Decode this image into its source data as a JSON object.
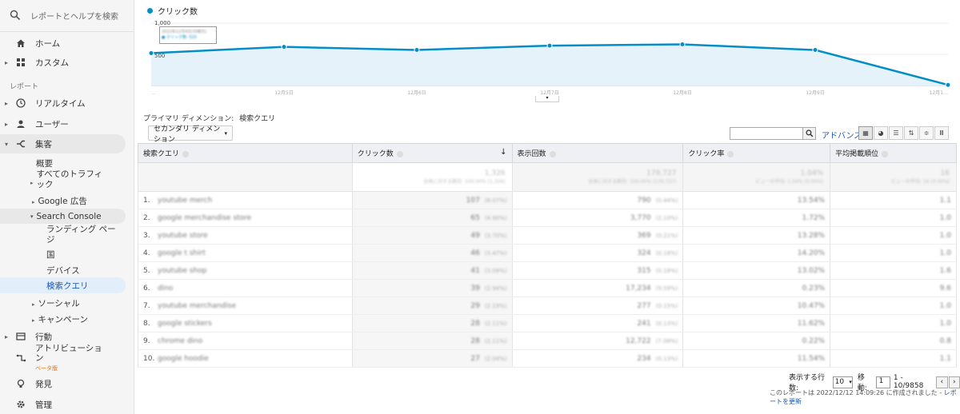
{
  "sidebar": {
    "search_label": "レポートとヘルプを検索",
    "home": "ホーム",
    "custom": "カスタム",
    "section_reports": "レポート",
    "realtime": "リアルタイム",
    "user": "ユーザー",
    "acquisition": "集客",
    "overview": "概要",
    "all_traffic_1": "すべてのトラフィ",
    "all_traffic_2": "ック",
    "google_ads": "Google 広告",
    "search_console": "Search Console",
    "landing_1": "ランディング ペー",
    "landing_2": "ジ",
    "country": "国",
    "device": "デバイス",
    "search_query": "検索クエリ",
    "social": "ソーシャル",
    "campaign": "キャンペーン",
    "behavior": "行動",
    "attribution_1": "アトリビューショ",
    "attribution_2": "ン",
    "beta": "ベータ版",
    "discover": "発見",
    "admin": "管理"
  },
  "chart": {
    "legend": "クリック数",
    "ytop": "1,000",
    "ymid": "500",
    "x_labels": [
      "…",
      "12月5日",
      "12月6日",
      "12月7日",
      "12月8日",
      "12月9日",
      "12月1…"
    ]
  },
  "chart_data": {
    "type": "area",
    "title": "",
    "series": [
      {
        "name": "クリック数",
        "values": [
          520,
          620,
          570,
          640,
          660,
          570,
          10
        ]
      }
    ],
    "ylim": [
      0,
      1000
    ],
    "x": [
      "…",
      "12月5日",
      "12月6日",
      "12月7日",
      "12月8日",
      "12月9日",
      "12月1…"
    ]
  },
  "toolbar": {
    "primary_dim_label": "プライマリ ディメンション:",
    "primary_dim_value": "検索クエリ",
    "secondary_dim": "セカンダリ ディメンション",
    "advance": "アドバンス"
  },
  "table": {
    "headers": [
      "検索クエリ",
      "クリック数",
      "表示回数",
      "クリック率",
      "平均掲載順位"
    ],
    "summary": [
      {
        "v": "1,326",
        "s": "全体に対する割合: 100.00% (1,326)"
      },
      {
        "v": "179,727",
        "s": "全体に対する割合: 100.00% (179,727)"
      },
      {
        "v": "1.04%",
        "s": "ビューの平均: 1.04% (0.00%)"
      },
      {
        "v": "16",
        "s": "ビューの平均: 16 (0.00%)"
      }
    ],
    "rows": [
      {
        "n": "1.",
        "q": "youtube merch",
        "c": "107",
        "cp": "(8.07%)",
        "i": "790",
        "ip": "(0.44%)",
        "ctr": "13.54%",
        "pos": "1.1"
      },
      {
        "n": "2.",
        "q": "google merchandise store",
        "c": "65",
        "cp": "(4.90%)",
        "i": "3,770",
        "ip": "(2.10%)",
        "ctr": "1.72%",
        "pos": "1.0"
      },
      {
        "n": "3.",
        "q": "youtube store",
        "c": "49",
        "cp": "(3.70%)",
        "i": "369",
        "ip": "(0.21%)",
        "ctr": "13.28%",
        "pos": "1.0"
      },
      {
        "n": "4.",
        "q": "google t shirt",
        "c": "46",
        "cp": "(3.47%)",
        "i": "324",
        "ip": "(0.18%)",
        "ctr": "14.20%",
        "pos": "1.0"
      },
      {
        "n": "5.",
        "q": "youtube shop",
        "c": "41",
        "cp": "(3.09%)",
        "i": "315",
        "ip": "(0.18%)",
        "ctr": "13.02%",
        "pos": "1.6"
      },
      {
        "n": "6.",
        "q": "dino",
        "c": "39",
        "cp": "(2.94%)",
        "i": "17,234",
        "ip": "(9.59%)",
        "ctr": "0.23%",
        "pos": "9.6"
      },
      {
        "n": "7.",
        "q": "youtube merchandise",
        "c": "29",
        "cp": "(2.19%)",
        "i": "277",
        "ip": "(0.15%)",
        "ctr": "10.47%",
        "pos": "1.0"
      },
      {
        "n": "8.",
        "q": "google stickers",
        "c": "28",
        "cp": "(2.11%)",
        "i": "241",
        "ip": "(0.13%)",
        "ctr": "11.62%",
        "pos": "1.0"
      },
      {
        "n": "9.",
        "q": "chrome dino",
        "c": "28",
        "cp": "(2.11%)",
        "i": "12,722",
        "ip": "(7.08%)",
        "ctr": "0.22%",
        "pos": "0.8"
      },
      {
        "n": "10.",
        "q": "google hoodie",
        "c": "27",
        "cp": "(2.04%)",
        "i": "234",
        "ip": "(0.13%)",
        "ctr": "11.54%",
        "pos": "1.1"
      }
    ]
  },
  "pager": {
    "rows_label": "表示する行数:",
    "rows_value": "10",
    "goto_label": "移動:",
    "goto_value": "1",
    "range": "1 - 10/9858"
  },
  "footer": {
    "created": "このレポートは 2022/12/12 14:09:26 に作成されました -",
    "refresh": "レポートを更新"
  }
}
